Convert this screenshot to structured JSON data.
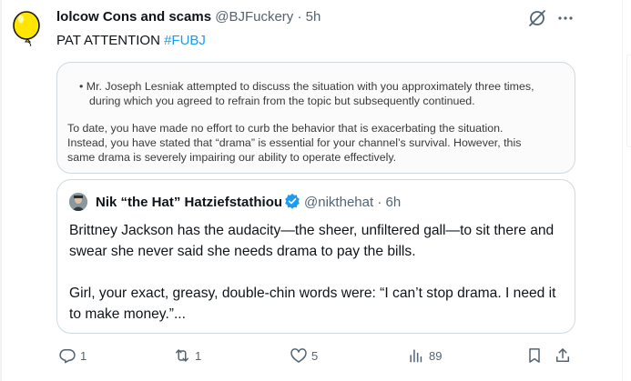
{
  "tweet": {
    "author_name": "lolcow Cons and scams",
    "author_handle": "@BJFuckery",
    "separator": "·",
    "time": "5h",
    "text": "PAT ATTENTION",
    "hashtag": "#FUBJ"
  },
  "image_doc": {
    "line1": "•  Mr. Joseph Lesniak attempted to discuss the situation with you approximately three times,",
    "line2": "during which you agreed to refrain from the topic but subsequently continued.",
    "line3": "To date, you have made no effort to curb the behavior that is exacerbating the situation.",
    "line4": "Instead, you have stated that “drama” is essential for your channel’s survival. However, this",
    "line5": "same drama is severely impairing our ability to operate effectively."
  },
  "quoted": {
    "author_name": "Nik “the Hat” Hatziefstathiou",
    "author_handle": "@nikthehat",
    "separator": "·",
    "time": "6h",
    "para1": "Brittney Jackson has the audacity—the sheer, unfiltered gall—to sit there and swear she never said she needs drama to pay the bills.",
    "para2": "Girl, your exact, greasy, double-chin words were: “I can’t stop drama. I need it to make money.”..."
  },
  "actions": {
    "replies": "1",
    "reposts": "1",
    "likes": "5",
    "views": "89"
  },
  "colors": {
    "accent": "#1d9bf0",
    "muted": "#536471",
    "avatar": "#ffe600"
  }
}
